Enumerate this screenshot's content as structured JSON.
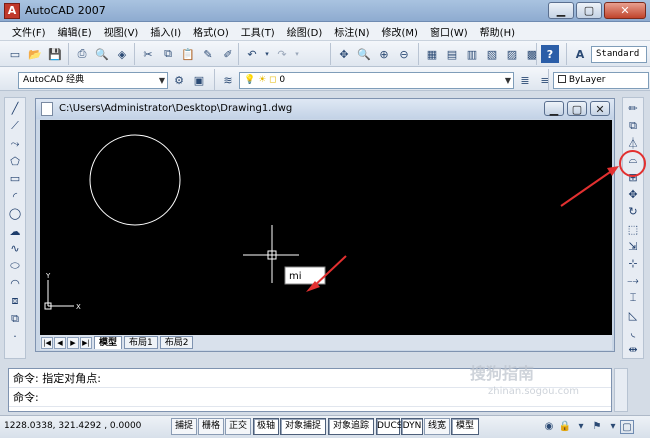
{
  "window": {
    "title": "AutoCAD 2007",
    "minimize": "▁",
    "maximize": "▢",
    "close": "✕"
  },
  "menu": [
    "文件(F)",
    "编辑(E)",
    "视图(V)",
    "插入(I)",
    "格式(O)",
    "工具(T)",
    "绘图(D)",
    "标注(N)",
    "修改(M)",
    "窗口(W)",
    "帮助(H)"
  ],
  "toolbar": {
    "text_style": "Standard",
    "workspace": "AutoCAD 经典",
    "layer": "0",
    "color": "ByLayer"
  },
  "drawing": {
    "path": "C:\\Users\\Administrator\\Desktop\\Drawing1.dwg",
    "ucs_y": "Y",
    "ucs_x": "X",
    "dynamic_input": "mi",
    "tabs": [
      "模型",
      "布局1",
      "布局2"
    ],
    "active_tab": "模型"
  },
  "command": {
    "history": "命令: 指定对角点:",
    "prompt": "命令:"
  },
  "status": {
    "coordinates": "1228.0338, 321.4292 , 0.0000",
    "buttons": [
      "捕捉",
      "栅格",
      "正交",
      "极轴",
      "对象捕捉",
      "对象追踪",
      "DUCS",
      "DYN",
      "线宽",
      "模型"
    ],
    "active": [
      "极轴",
      "对象捕捉",
      "对象追踪",
      "DUCS",
      "DYN",
      "模型"
    ]
  },
  "watermark": {
    "text": "搜狗指南",
    "sub": "zhinan.sogou.com"
  },
  "colors": {
    "canvas": "#000000",
    "annotation": "#e23030",
    "drawing_lines": "#ffffff"
  },
  "icons": {
    "left_toolbar": [
      "line-icon",
      "construction-line-icon",
      "polyline-icon",
      "polygon-icon",
      "rectangle-icon",
      "arc-icon",
      "circle-icon",
      "revision-cloud-icon",
      "spline-icon",
      "ellipse-icon",
      "ellipse-arc-icon",
      "insert-block-icon",
      "make-block-icon",
      "point-icon"
    ],
    "right_toolbar": [
      "erase-icon",
      "copy-icon",
      "mirror-icon",
      "offset-icon",
      "array-icon",
      "move-icon",
      "rotate-icon",
      "scale-icon",
      "stretch-icon",
      "trim-icon",
      "extend-icon",
      "break-icon",
      "chamfer-icon",
      "fillet-icon",
      "explode-icon"
    ]
  }
}
